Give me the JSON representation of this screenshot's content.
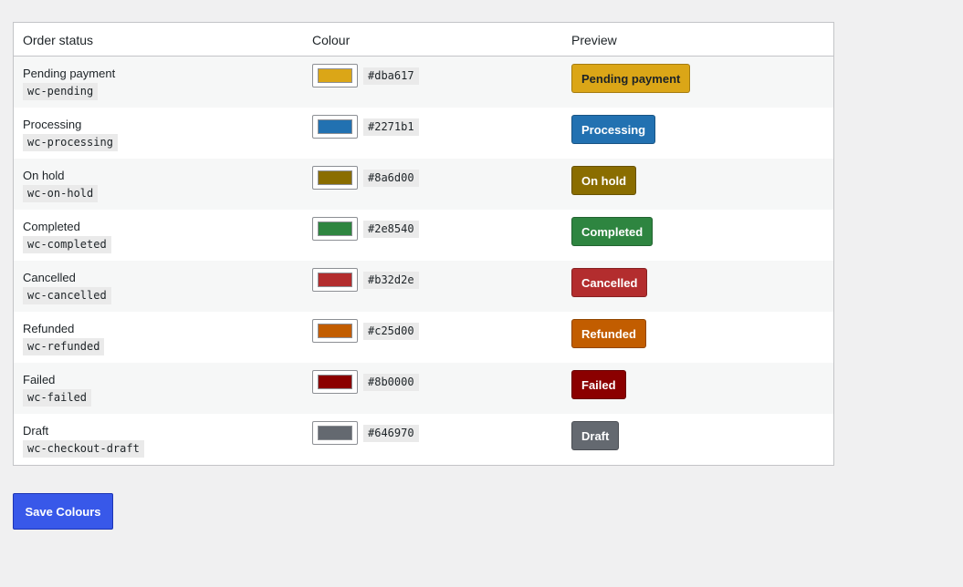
{
  "table": {
    "headers": {
      "status": "Order status",
      "colour": "Colour",
      "preview": "Preview"
    },
    "rows": [
      {
        "name": "Pending payment",
        "slug": "wc-pending",
        "hex": "#dba617",
        "color": "#dba617",
        "text_color": "#1d2327"
      },
      {
        "name": "Processing",
        "slug": "wc-processing",
        "hex": "#2271b1",
        "color": "#2271b1",
        "text_color": "#ffffff"
      },
      {
        "name": "On hold",
        "slug": "wc-on-hold",
        "hex": "#8a6d00",
        "color": "#8a6d00",
        "text_color": "#ffffff"
      },
      {
        "name": "Completed",
        "slug": "wc-completed",
        "hex": "#2e8540",
        "color": "#2e8540",
        "text_color": "#ffffff"
      },
      {
        "name": "Cancelled",
        "slug": "wc-cancelled",
        "hex": "#b32d2e",
        "color": "#b32d2e",
        "text_color": "#ffffff"
      },
      {
        "name": "Refunded",
        "slug": "wc-refunded",
        "hex": "#c25d00",
        "color": "#c25d00",
        "text_color": "#ffffff"
      },
      {
        "name": "Failed",
        "slug": "wc-failed",
        "hex": "#8b0000",
        "color": "#8b0000",
        "text_color": "#ffffff"
      },
      {
        "name": "Draft",
        "slug": "wc-checkout-draft",
        "hex": "#646970",
        "color": "#646970",
        "text_color": "#ffffff"
      }
    ]
  },
  "actions": {
    "save_label": "Save Colours",
    "save_color": "#3858e9"
  }
}
